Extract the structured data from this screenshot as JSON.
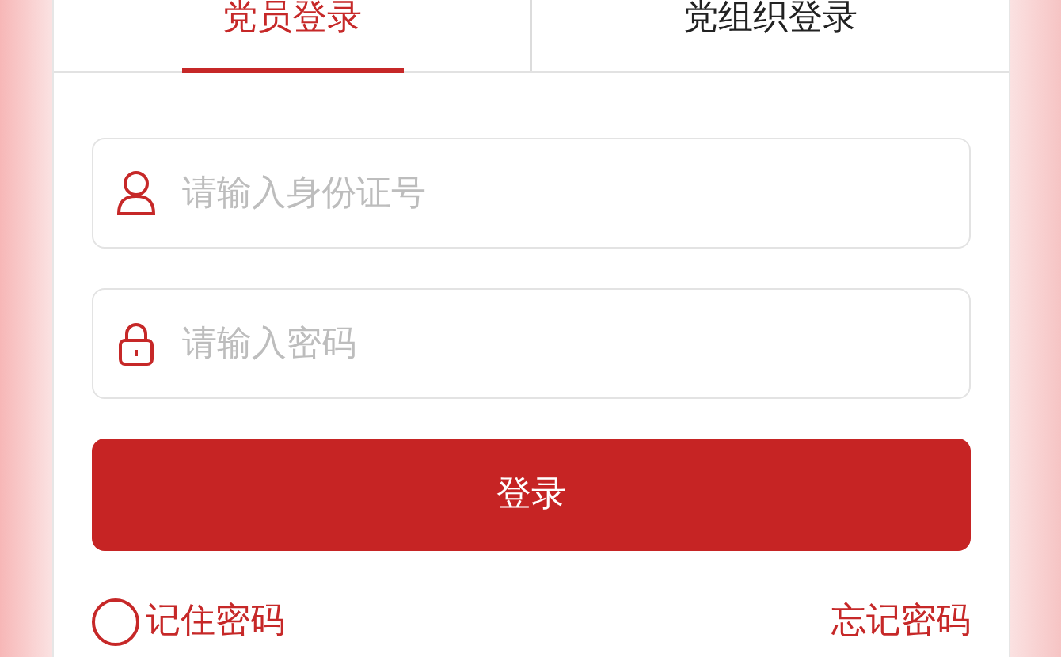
{
  "tabs": [
    {
      "label": "党员登录",
      "selected": true
    },
    {
      "label": "党组织登录",
      "selected": false
    }
  ],
  "id_field": {
    "placeholder": "请输入身份证号"
  },
  "password_field": {
    "placeholder": "请输入密码"
  },
  "login_button": "登录",
  "remember": {
    "label": "记住密码",
    "checked": false
  },
  "forgot_link": "忘记密码"
}
